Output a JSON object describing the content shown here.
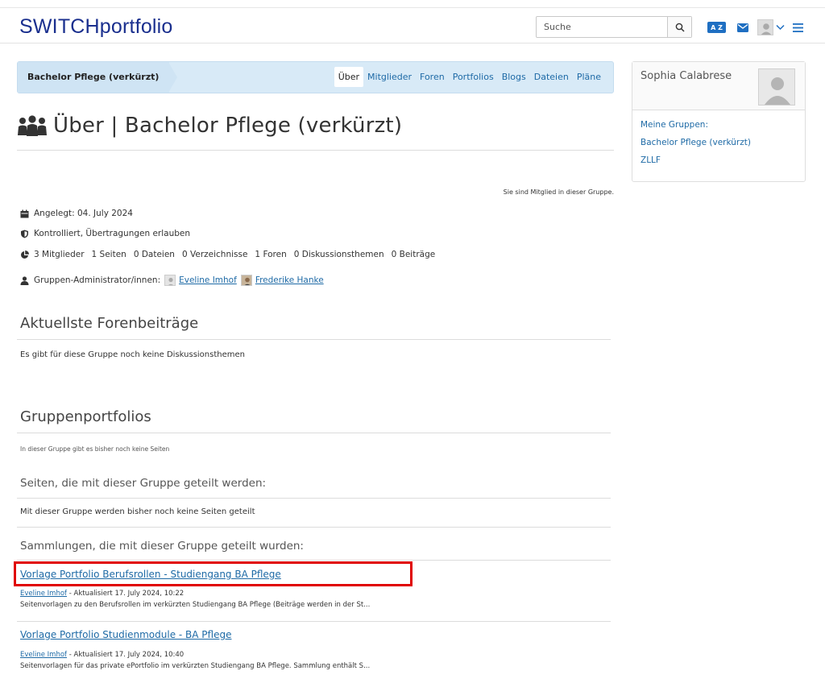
{
  "header": {
    "logo": "SWITCHportfolio",
    "search_placeholder": "Suche",
    "lang_label": "A Z"
  },
  "breadcrumb": "Bachelor Pflege (verkürzt)",
  "tabs": [
    "Über",
    "Mitglieder",
    "Foren",
    "Portfolios",
    "Blogs",
    "Dateien",
    "Pläne"
  ],
  "page_title": "Über | Bachelor Pflege (verkürzt)",
  "member_note": "Sie sind Mitglied in dieser Gruppe.",
  "info": {
    "created": "Angelegt: 04. July 2024",
    "type": "Kontrolliert, Übertragungen erlauben",
    "stats": [
      "3 Mitglieder",
      "1 Seiten",
      "0 Dateien",
      "0 Verzeichnisse",
      "1 Foren",
      "0 Diskussionsthemen",
      "0 Beiträge"
    ],
    "admins_label": "Gruppen-Administrator/innen:",
    "admins": [
      "Eveline Imhof",
      "Frederike Hanke"
    ]
  },
  "forum": {
    "heading": "Aktuellste Forenbeiträge",
    "empty": "Es gibt für diese Gruppe noch keine Diskussionsthemen"
  },
  "portfolios": {
    "heading": "Gruppenportfolios",
    "empty": "In dieser Gruppe gibt es bisher noch keine Seiten",
    "shared_pages_heading": "Seiten, die mit dieser Gruppe geteilt werden:",
    "shared_pages_empty": "Mit dieser Gruppe werden bisher noch keine Seiten geteilt",
    "collections_heading": "Sammlungen, die mit dieser Gruppe geteilt wurden:",
    "collections": [
      {
        "title": "Vorlage Portfolio Berufsrollen - Studiengang BA Pflege",
        "author": "Eveline Imhof",
        "updated": " - Aktualisiert 17. July 2024, 10:22",
        "desc": "Seitenvorlagen zu den Berufsrollen im verkürzten Studiengang BA Pflege (Beiträge werden in der St..."
      },
      {
        "title": "Vorlage Portfolio Studienmodule - BA Pflege",
        "author": "Eveline Imhof",
        "updated": " - Aktualisiert 17. July 2024, 10:40",
        "desc": "Seitenvorlagen für das private ePortfolio im verkürzten Studiengang BA Pflege. Sammlung enthält S..."
      }
    ]
  },
  "sidebar": {
    "user": "Sophia Calabrese",
    "links": [
      "Meine Gruppen:",
      "Bachelor Pflege (verkürzt)",
      "ZLLF"
    ]
  },
  "colors": {
    "brand": "#1a2f8e",
    "link": "#1e6aa6",
    "navbar": "#d8eaf7",
    "highlight": "#e00000"
  }
}
